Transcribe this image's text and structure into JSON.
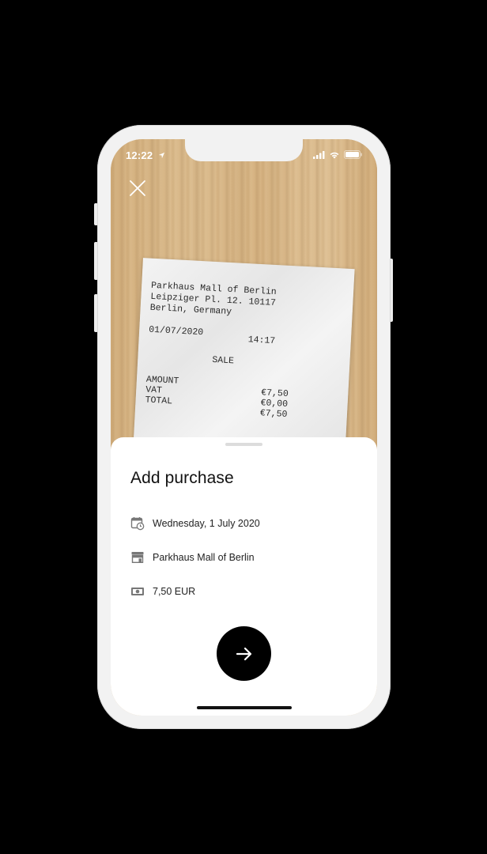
{
  "status_bar": {
    "time": "12:22",
    "icons": [
      "location-arrow-icon",
      "signal-icon",
      "wifi-icon",
      "battery-icon"
    ]
  },
  "camera": {
    "close_icon": "close-icon",
    "receipt": {
      "line1": "Parkhaus Mall of Berlin",
      "line2": "Leipziger Pl. 12. 10117",
      "line3": "Berlin, Germany",
      "date": "01/07/2020",
      "time": "14:17",
      "sale": "SALE",
      "amount_label": "AMOUNT",
      "vat_label": "VAT",
      "total_label": "TOTAL",
      "amount_value": "€7,50",
      "vat_value": "€0,00",
      "total_value": "€7,50"
    }
  },
  "sheet": {
    "title": "Add purchase",
    "rows": [
      {
        "icon": "calendar-clock-icon",
        "text": "Wednesday, 1 July 2020"
      },
      {
        "icon": "store-icon",
        "text": "Parkhaus Mall of Berlin"
      },
      {
        "icon": "cash-icon",
        "text": "7,50 EUR"
      }
    ],
    "next_icon": "arrow-right-icon"
  },
  "colors": {
    "background": "#000000",
    "sheet": "#ffffff",
    "accent": "#000000",
    "wood": "#d8b888"
  }
}
